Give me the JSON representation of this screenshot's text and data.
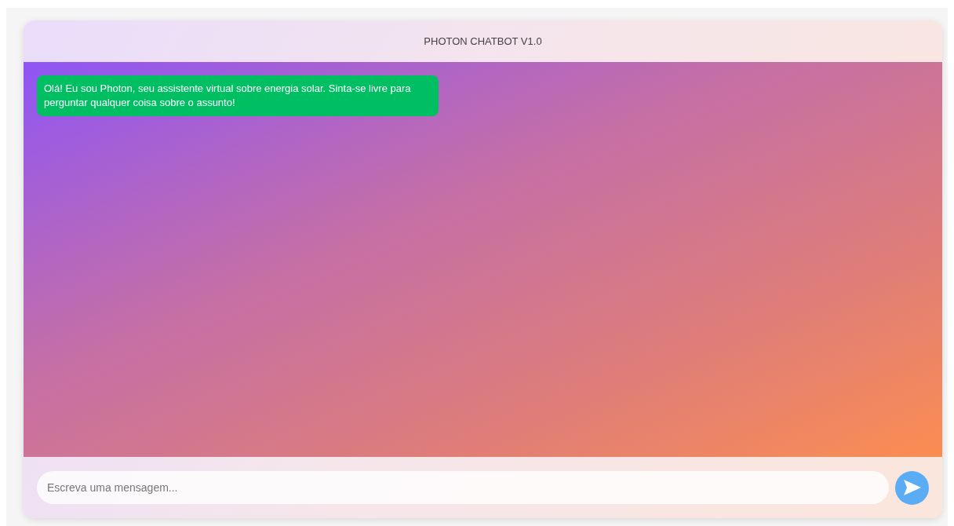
{
  "header": {
    "title": "PHOTON CHATBOT V1.0"
  },
  "messages": [
    {
      "kind": "bot",
      "text": "Olá! Eu sou Photon, seu assistente virtual sobre energia solar. Sinta-se livre para perguntar qualquer coisa sobre o assunto!"
    }
  ],
  "composer": {
    "placeholder": "Escreva uma mensagem..."
  }
}
